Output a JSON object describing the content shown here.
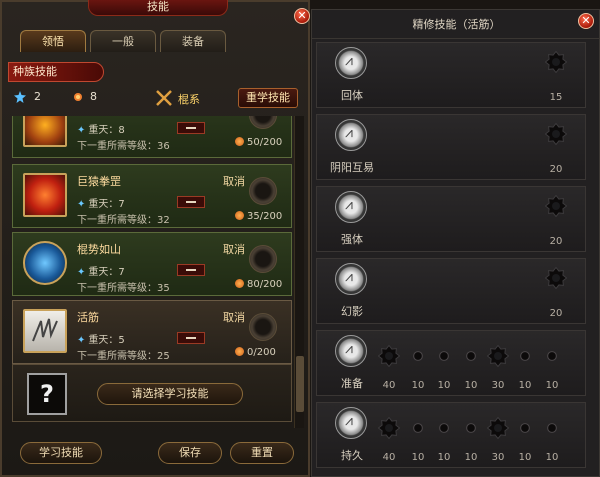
{
  "left_panel": {
    "title": "技能",
    "tabs": [
      "领悟",
      "一般",
      "装备"
    ],
    "race_label": "种族技能",
    "stats": {
      "star_points": "2",
      "sun_points": "8",
      "system": "棍系"
    },
    "relearn_label": "重学技能",
    "skills": [
      {
        "name": "",
        "cancel": "",
        "level": "重天：8",
        "next": "下一重所需等级：36",
        "progress": "50/200",
        "style": "green"
      },
      {
        "name": "巨猿拳罡",
        "cancel": "取消",
        "level": "重天：7",
        "next": "下一重所需等级：32",
        "progress": "35/200",
        "style": "green"
      },
      {
        "name": "棍势如山",
        "cancel": "取消",
        "level": "重天：7",
        "next": "下一重所需等级：35",
        "progress": "80/200",
        "style": "green"
      },
      {
        "name": "活筋",
        "cancel": "取消",
        "level": "重天：5",
        "next": "下一重所需等级：25",
        "progress": "0/200",
        "style": "brown"
      }
    ],
    "choose_icon": "?",
    "choose_label": "请选择学习技能",
    "bottom_buttons": [
      "学习技能",
      "保存",
      "重置"
    ]
  },
  "right_panel": {
    "title": "精修技能（活筋）",
    "rows": [
      {
        "name": "回体",
        "nodes": [
          {
            "value": "15"
          }
        ]
      },
      {
        "name": "阴阳互易",
        "nodes": [
          {
            "value": "20"
          }
        ]
      },
      {
        "name": "强体",
        "nodes": [
          {
            "value": "20"
          }
        ]
      },
      {
        "name": "幻影",
        "nodes": [
          {
            "value": "20"
          }
        ]
      },
      {
        "name": "准备",
        "nodes": [
          {
            "value": "40"
          },
          {
            "value": "10"
          },
          {
            "value": "10"
          },
          {
            "value": "10"
          },
          {
            "value": "30"
          },
          {
            "value": "10"
          },
          {
            "value": "10"
          }
        ]
      },
      {
        "name": "持久",
        "nodes": [
          {
            "value": "40"
          },
          {
            "value": "10"
          },
          {
            "value": "10"
          },
          {
            "value": "10"
          },
          {
            "value": "30"
          },
          {
            "value": "10"
          },
          {
            "value": "10"
          }
        ]
      }
    ]
  },
  "icons": {
    "close": "close-icon",
    "star": "star-icon",
    "sun": "sun-icon",
    "crossed_staves": "crossed-staves-icon"
  }
}
